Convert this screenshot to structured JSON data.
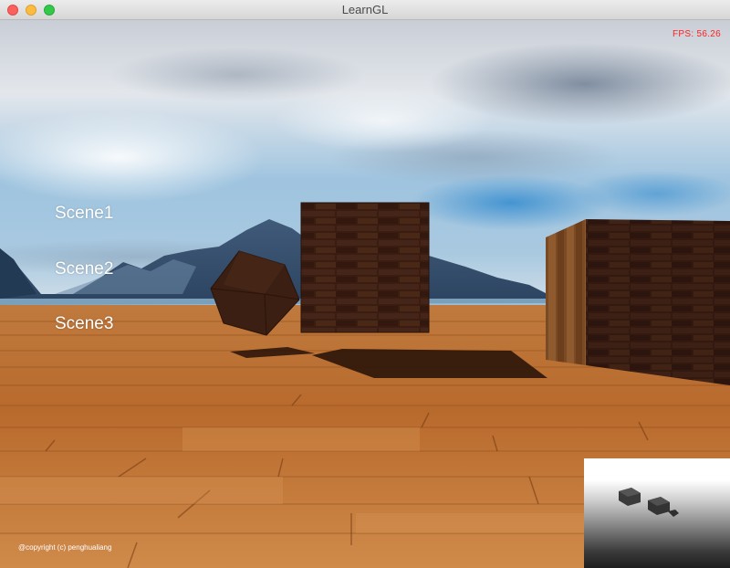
{
  "window": {
    "title": "LearnGL",
    "buttons": [
      "close",
      "minimize",
      "maximize"
    ]
  },
  "hud": {
    "fps": "FPS: 56.26",
    "fps_color": "#ff2020"
  },
  "menu": {
    "items": [
      "Scene1",
      "Scene2",
      "Scene3"
    ]
  },
  "footer": {
    "copyright": "@copyright (c) penghualiang"
  },
  "icons": {
    "close": "close-icon",
    "minimize": "minimize-icon",
    "maximize": "maximize-icon"
  },
  "colors": {
    "floor": "#c0702a",
    "crate": "#3a1c10",
    "sky_blue": "#4a90c8",
    "close": "#fc605c",
    "minimize": "#fdbc40",
    "maximize": "#34c84a"
  }
}
